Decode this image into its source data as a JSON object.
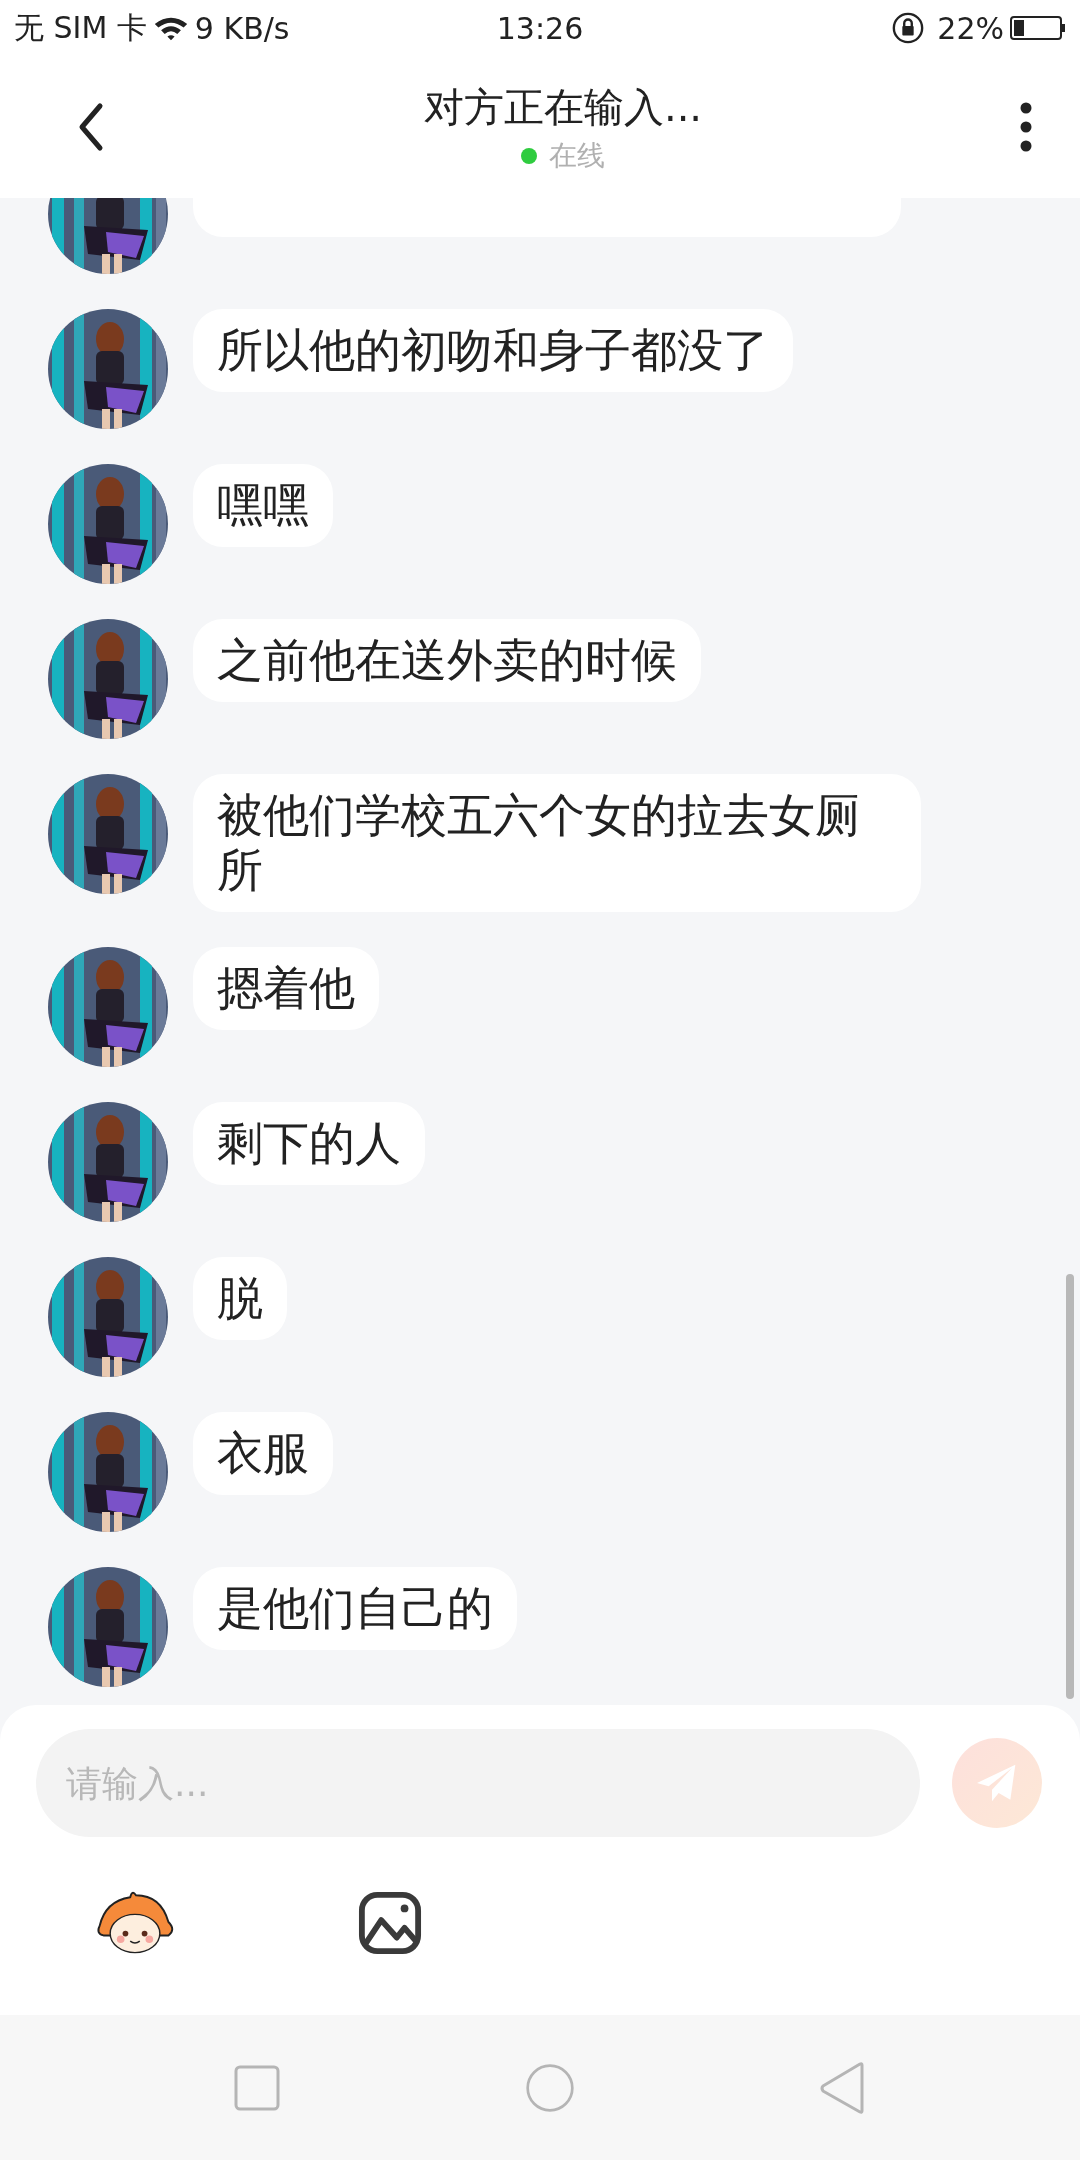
{
  "status_bar": {
    "carrier": "无 SIM 卡",
    "network_speed": "9 KB/s",
    "time": "13:26",
    "battery": "22%"
  },
  "header": {
    "title": "对方正在输入...",
    "status": "在线",
    "online": true
  },
  "messages": [
    {
      "kind": "cut"
    },
    {
      "kind": "text",
      "text": "所以他的初吻和身子都没了"
    },
    {
      "kind": "text",
      "text": "嘿嘿"
    },
    {
      "kind": "text",
      "text": "之前他在送外卖的时候"
    },
    {
      "kind": "text",
      "text": "被他们学校五六个女的拉去女厕所"
    },
    {
      "kind": "text",
      "text": "摁着他"
    },
    {
      "kind": "text",
      "text": "剩下的人"
    },
    {
      "kind": "text",
      "text": "脱"
    },
    {
      "kind": "text",
      "text": "衣服"
    },
    {
      "kind": "text",
      "text": "是他们自己的"
    }
  ],
  "composer": {
    "placeholder": "请输入..."
  }
}
